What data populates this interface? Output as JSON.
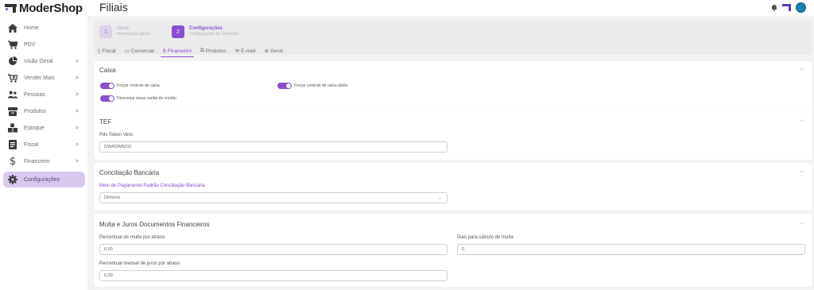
{
  "brand": {
    "name": "ModerShop"
  },
  "header": {
    "title": "Filiais"
  },
  "sidebar": {
    "items": [
      {
        "label": "Home",
        "icon": "home-icon",
        "arrow": false
      },
      {
        "label": "PDV",
        "icon": "cart-icon",
        "arrow": false
      },
      {
        "label": "Visão Geral",
        "icon": "pie-chart-icon",
        "arrow": true
      },
      {
        "label": "Vender Mais",
        "icon": "cart-plus-icon",
        "arrow": true
      },
      {
        "label": "Pessoas",
        "icon": "people-icon",
        "arrow": true
      },
      {
        "label": "Produtos",
        "icon": "box-icon",
        "arrow": true
      },
      {
        "label": "Estoque",
        "icon": "boxes-icon",
        "arrow": true
      },
      {
        "label": "Fiscal",
        "icon": "document-icon",
        "arrow": true
      },
      {
        "label": "Financeiro",
        "icon": "dollar-icon",
        "arrow": true
      },
      {
        "label": "Configurações",
        "icon": "gear-icon",
        "arrow": false,
        "active": true
      }
    ]
  },
  "steps": [
    {
      "number": "1",
      "title": "Geral",
      "subtitle": "Informações gerais"
    },
    {
      "number": "2",
      "title": "Configurações",
      "subtitle": "Configurações de Operação"
    }
  ],
  "tabs": [
    {
      "label": "Fiscal",
      "icon": "document-icon"
    },
    {
      "label": "Comercial",
      "icon": "calendar-icon"
    },
    {
      "label": "Financeiro",
      "icon": "dollar-icon",
      "active": true
    },
    {
      "label": "Produtos",
      "icon": "box-icon"
    },
    {
      "label": "E-mail",
      "icon": "mail-icon"
    },
    {
      "label": "Geral",
      "icon": "globe-icon"
    }
  ],
  "caixa": {
    "title": "Caixa",
    "toggles": [
      {
        "label": "Forçar controle de caixa",
        "on": true
      },
      {
        "label": "Forçar controle de caixa diário",
        "on": true
      },
      {
        "label": "Descontar taxas cartão de crédito",
        "on": true
      }
    ]
  },
  "tef": {
    "title": "TEF",
    "field_label": "Pdv Token Vero",
    "field_value": "DWADWA232"
  },
  "conciliacao": {
    "title": "Conciliação Bancária",
    "field_label": "Meio de Pagamento Padrão Conciliação Bancária",
    "field_value": "Dinheiro"
  },
  "multa": {
    "title": "Multa e Juros Documentos Financeiros",
    "multa_label": "Percentual de multa por atraso",
    "multa_value": "0,00",
    "dias_label": "Dias para cálculo de multa",
    "dias_value": "0",
    "juros_label": "Percentual mensal de juros por atraso",
    "juros_value": "0,00"
  },
  "colors": {
    "accent": "#8a4fce",
    "active_nav": "#d9c8ee"
  }
}
